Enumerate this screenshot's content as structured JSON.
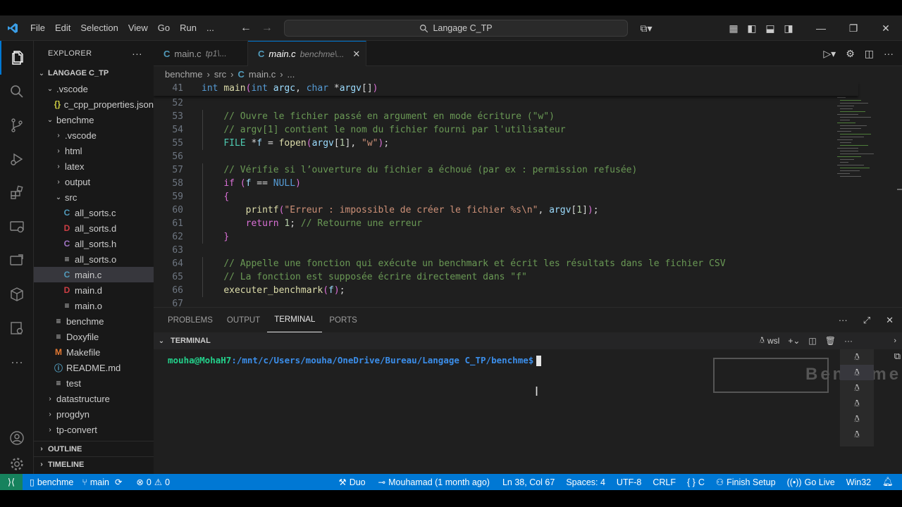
{
  "menu": [
    "File",
    "Edit",
    "Selection",
    "View",
    "Go",
    "Run",
    "..."
  ],
  "search": {
    "label": "Langage C_TP"
  },
  "explorer": {
    "title": "EXPLORER",
    "root": "LANGAGE C_TP",
    "tree": [
      {
        "label": ".vscode",
        "kind": "folder-open",
        "indent": 1
      },
      {
        "label": "c_cpp_properties.json",
        "kind": "json",
        "icon": "{}",
        "indent": 2
      },
      {
        "label": "benchme",
        "kind": "folder-open",
        "indent": 1
      },
      {
        "label": ".vscode",
        "kind": "folder",
        "indent": 2
      },
      {
        "label": "html",
        "kind": "folder",
        "indent": 2
      },
      {
        "label": "latex",
        "kind": "folder",
        "indent": 2
      },
      {
        "label": "output",
        "kind": "folder",
        "indent": 2
      },
      {
        "label": "src",
        "kind": "folder-open",
        "indent": 2
      },
      {
        "label": "all_sorts.c",
        "kind": "c",
        "icon": "C",
        "indent": 3
      },
      {
        "label": "all_sorts.d",
        "kind": "d",
        "icon": "D",
        "indent": 3
      },
      {
        "label": "all_sorts.h",
        "kind": "h",
        "icon": "C",
        "indent": 3
      },
      {
        "label": "all_sorts.o",
        "kind": "o",
        "icon": "≡",
        "indent": 3
      },
      {
        "label": "main.c",
        "kind": "c",
        "icon": "C",
        "indent": 3,
        "selected": true
      },
      {
        "label": "main.d",
        "kind": "d",
        "icon": "D",
        "indent": 3
      },
      {
        "label": "main.o",
        "kind": "o",
        "icon": "≡",
        "indent": 3
      },
      {
        "label": "benchme",
        "kind": "file",
        "icon": "≡",
        "indent": 2
      },
      {
        "label": "Doxyfile",
        "kind": "file",
        "icon": "≡",
        "indent": 2
      },
      {
        "label": "Makefile",
        "kind": "make",
        "icon": "M",
        "indent": 2
      },
      {
        "label": "README.md",
        "kind": "info",
        "icon": "ⓘ",
        "indent": 2
      },
      {
        "label": "test",
        "kind": "file",
        "icon": "≡",
        "indent": 2
      },
      {
        "label": "datastructure",
        "kind": "folder",
        "indent": 1
      },
      {
        "label": "progdyn",
        "kind": "folder",
        "indent": 1
      },
      {
        "label": "tp-convert",
        "kind": "folder",
        "indent": 1
      }
    ],
    "outline": "OUTLINE",
    "timeline": "TIMELINE"
  },
  "tabs": [
    {
      "name": "main.c",
      "desc": "tp1\\...",
      "active": false
    },
    {
      "name": "main.c",
      "desc": "benchme\\...",
      "active": true
    }
  ],
  "breadcrumb": [
    "benchme",
    "src",
    "main.c",
    "..."
  ],
  "code": [
    {
      "n": "41",
      "html": "<span class='kw'>int</span> <span class='fn'>main</span><span class='br'>(</span><span class='kw'>int</span> <span class='id'>argc</span><span class='pl'>, </span><span class='kw'>char</span> <span class='pl'>*</span><span class='id'>argv</span><span class='pl'>[]</span><span class='br'>)</span>",
      "sticky": true
    },
    {
      "n": "52",
      "html": ""
    },
    {
      "n": "53",
      "html": "    <span class='cm'>// Ouvre le fichier passé en argument en mode écriture (\"w\")</span>"
    },
    {
      "n": "54",
      "html": "    <span class='cm'>// argv[1] contient le nom du fichier fourni par l'utilisateur</span>"
    },
    {
      "n": "55",
      "html": "    <span class='ty'>FILE</span> <span class='pl'>*</span><span class='id'>f</span> <span class='pl'>=</span> <span class='fn'>fopen</span><span class='br'>(</span><span class='id'>argv</span><span class='pl'>[</span><span class='nm'>1</span><span class='pl'>], </span><span class='st'>\"w\"</span><span class='br'>)</span><span class='pl'>;</span>"
    },
    {
      "n": "56",
      "html": ""
    },
    {
      "n": "57",
      "html": "    <span class='cm'>// Vérifie si l’ouverture du fichier a échoué (par ex : permission refusée)</span>"
    },
    {
      "n": "58",
      "html": "    <span class='br'>if</span> <span class='br'>(</span><span class='id'>f</span> <span class='pl'>==</span> <span class='kw'>NULL</span><span class='br'>)</span>"
    },
    {
      "n": "59",
      "html": "    <span class='br'>{</span>"
    },
    {
      "n": "60",
      "html": "        <span class='fn'>printf</span><span class='br'>(</span><span class='st'>\"Erreur : impossible de créer le fichier %s\\n\"</span><span class='pl'>, </span><span class='id'>argv</span><span class='pl'>[</span><span class='nm'>1</span><span class='pl'>]</span><span class='br'>)</span><span class='pl'>;</span>"
    },
    {
      "n": "61",
      "html": "        <span class='br'>return</span> <span class='nm'>1</span><span class='pl'>; </span><span class='cm'>// Retourne une erreur</span>"
    },
    {
      "n": "62",
      "html": "    <span class='br'>}</span>"
    },
    {
      "n": "63",
      "html": ""
    },
    {
      "n": "64",
      "html": "    <span class='cm'>// Appelle une fonction qui exécute un benchmark et écrit les résultats dans le fichier CSV</span>"
    },
    {
      "n": "65",
      "html": "    <span class='cm'>// La fonction est supposée écrire directement dans \"f\"</span>"
    },
    {
      "n": "66",
      "html": "    <span class='fn'>executer_benchmark</span><span class='br'>(</span><span class='id'>f</span><span class='br'>)</span><span class='pl'>;</span>"
    },
    {
      "n": "67",
      "html": ""
    }
  ],
  "panel": {
    "tabs": [
      "PROBLEMS",
      "OUTPUT",
      "TERMINAL",
      "PORTS"
    ],
    "active_tab": "TERMINAL",
    "terminal_title": "TERMINAL",
    "shell_name": "wsl",
    "prompt_user": "mouha@MohaH7",
    "prompt_path": ":/mnt/c/Users/mouha/OneDrive/Bureau/Langage C_TP/benchme$",
    "overlay_text": "Benchme"
  },
  "status": {
    "branch_folder": "benchme",
    "branch": "main",
    "errors": "0",
    "warnings": "0",
    "duo": "Duo",
    "blame": "Mouhamad (1 month ago)",
    "position": "Ln 38, Col 67",
    "spaces": "Spaces: 4",
    "encoding": "UTF-8",
    "eol": "CRLF",
    "language": "C",
    "finish_setup": "Finish Setup",
    "go_live": "Go Live",
    "platform": "Win32"
  }
}
